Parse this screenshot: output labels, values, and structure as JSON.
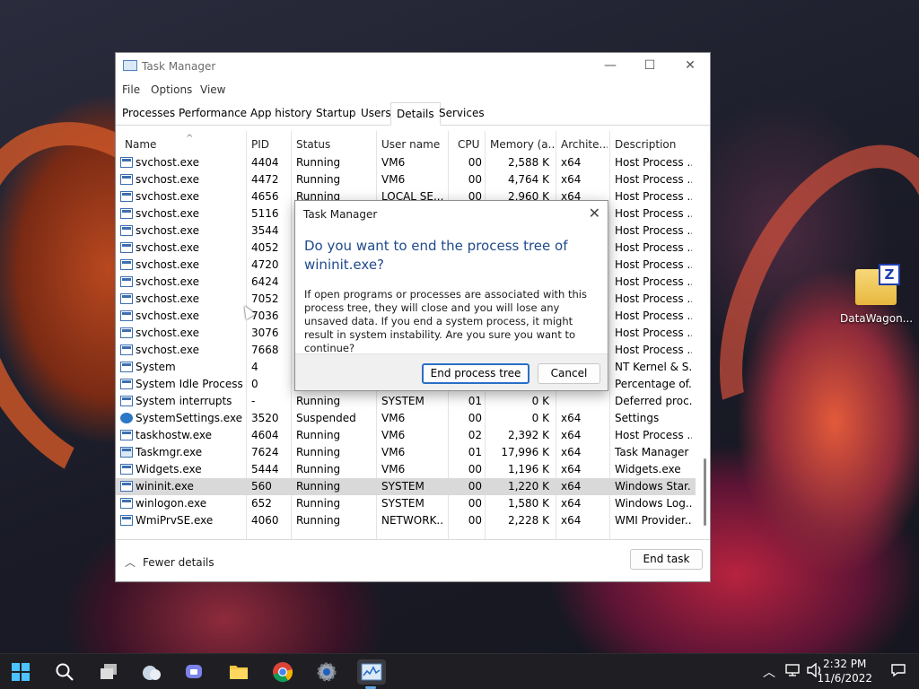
{
  "desktop": {
    "icon_label": "DataWagon...",
    "icon_badge": "Z"
  },
  "window": {
    "title": "Task Manager",
    "controls": {
      "minimize": "—",
      "maximize": "☐",
      "close": "✕"
    }
  },
  "menu": [
    "File",
    "Options",
    "View"
  ],
  "tabs": [
    {
      "label": "Processes",
      "active": false
    },
    {
      "label": "Performance",
      "active": false
    },
    {
      "label": "App history",
      "active": false
    },
    {
      "label": "Startup",
      "active": false
    },
    {
      "label": "Users",
      "active": false
    },
    {
      "label": "Details",
      "active": true
    },
    {
      "label": "Services",
      "active": false
    }
  ],
  "columns": [
    "Name",
    "PID",
    "Status",
    "User name",
    "CPU",
    "Memory (a...",
    "Archite...",
    "Description"
  ],
  "rows": [
    {
      "name": "svchost.exe",
      "pid": "4404",
      "status": "Running",
      "user": "VM6",
      "cpu": "00",
      "mem": "2,588 K",
      "arch": "x64",
      "desc": "Host Process ...",
      "icon": "process"
    },
    {
      "name": "svchost.exe",
      "pid": "4472",
      "status": "Running",
      "user": "VM6",
      "cpu": "00",
      "mem": "4,764 K",
      "arch": "x64",
      "desc": "Host Process ...",
      "icon": "process"
    },
    {
      "name": "svchost.exe",
      "pid": "4656",
      "status": "Running",
      "user": "LOCAL SE...",
      "cpu": "00",
      "mem": "2,960 K",
      "arch": "x64",
      "desc": "Host Process ...",
      "icon": "process"
    },
    {
      "name": "svchost.exe",
      "pid": "5116",
      "status": "",
      "user": "",
      "cpu": "",
      "mem": "",
      "arch": "",
      "desc": "Host Process ...",
      "icon": "process"
    },
    {
      "name": "svchost.exe",
      "pid": "3544",
      "status": "",
      "user": "",
      "cpu": "",
      "mem": "",
      "arch": "",
      "desc": "Host Process ...",
      "icon": "process"
    },
    {
      "name": "svchost.exe",
      "pid": "4052",
      "status": "",
      "user": "",
      "cpu": "",
      "mem": "",
      "arch": "",
      "desc": "Host Process ...",
      "icon": "process"
    },
    {
      "name": "svchost.exe",
      "pid": "4720",
      "status": "",
      "user": "",
      "cpu": "",
      "mem": "",
      "arch": "",
      "desc": "Host Process ...",
      "icon": "process"
    },
    {
      "name": "svchost.exe",
      "pid": "6424",
      "status": "",
      "user": "",
      "cpu": "",
      "mem": "",
      "arch": "",
      "desc": "Host Process ...",
      "icon": "process"
    },
    {
      "name": "svchost.exe",
      "pid": "7052",
      "status": "",
      "user": "",
      "cpu": "",
      "mem": "",
      "arch": "",
      "desc": "Host Process ...",
      "icon": "process"
    },
    {
      "name": "svchost.exe",
      "pid": "7036",
      "status": "",
      "user": "",
      "cpu": "",
      "mem": "",
      "arch": "",
      "desc": "Host Process ...",
      "icon": "process"
    },
    {
      "name": "svchost.exe",
      "pid": "3076",
      "status": "",
      "user": "",
      "cpu": "",
      "mem": "",
      "arch": "",
      "desc": "Host Process ...",
      "icon": "process"
    },
    {
      "name": "svchost.exe",
      "pid": "7668",
      "status": "",
      "user": "",
      "cpu": "",
      "mem": "",
      "arch": "",
      "desc": "Host Process ...",
      "icon": "process"
    },
    {
      "name": "System",
      "pid": "4",
      "status": "",
      "user": "",
      "cpu": "",
      "mem": "",
      "arch": "",
      "desc": "NT Kernel & S...",
      "icon": "process"
    },
    {
      "name": "System Idle Process",
      "pid": "0",
      "status": "",
      "user": "",
      "cpu": "",
      "mem": "",
      "arch": "",
      "desc": "Percentage of...",
      "icon": "process"
    },
    {
      "name": "System interrupts",
      "pid": "-",
      "status": "Running",
      "user": "SYSTEM",
      "cpu": "01",
      "mem": "0 K",
      "arch": "",
      "desc": "Deferred proc...",
      "icon": "process"
    },
    {
      "name": "SystemSettings.exe",
      "pid": "3520",
      "status": "Suspended",
      "user": "VM6",
      "cpu": "00",
      "mem": "0 K",
      "arch": "x64",
      "desc": "Settings",
      "icon": "gear"
    },
    {
      "name": "taskhostw.exe",
      "pid": "4604",
      "status": "Running",
      "user": "VM6",
      "cpu": "02",
      "mem": "2,392 K",
      "arch": "x64",
      "desc": "Host Process ...",
      "icon": "process"
    },
    {
      "name": "Taskmgr.exe",
      "pid": "7624",
      "status": "Running",
      "user": "VM6",
      "cpu": "01",
      "mem": "17,996 K",
      "arch": "x64",
      "desc": "Task Manager",
      "icon": "taskmgr"
    },
    {
      "name": "Widgets.exe",
      "pid": "5444",
      "status": "Running",
      "user": "VM6",
      "cpu": "00",
      "mem": "1,196 K",
      "arch": "x64",
      "desc": "Widgets.exe",
      "icon": "process"
    },
    {
      "name": "wininit.exe",
      "pid": "560",
      "status": "Running",
      "user": "SYSTEM",
      "cpu": "00",
      "mem": "1,220 K",
      "arch": "x64",
      "desc": "Windows Star...",
      "icon": "process",
      "selected": true
    },
    {
      "name": "winlogon.exe",
      "pid": "652",
      "status": "Running",
      "user": "SYSTEM",
      "cpu": "00",
      "mem": "1,580 K",
      "arch": "x64",
      "desc": "Windows Log...",
      "icon": "process"
    },
    {
      "name": "WmiPrvSE.exe",
      "pid": "4060",
      "status": "Running",
      "user": "NETWORK...",
      "cpu": "00",
      "mem": "2,228 K",
      "arch": "x64",
      "desc": "WMI Provider...",
      "icon": "process"
    }
  ],
  "footer": {
    "fewer_details": "Fewer details",
    "end_task": "End task"
  },
  "dialog": {
    "title": "Task Manager",
    "heading": "Do you want to end the process tree of wininit.exe?",
    "body": "If open programs or processes are associated with this process tree, they will close and you will lose any unsaved data. If you end a system process, it might result in system instability. Are you sure you want to continue?",
    "confirm": "End process tree",
    "cancel": "Cancel"
  },
  "taskbar": {
    "time": "2:32 PM",
    "date": "11/6/2022",
    "apps": [
      "start-icon",
      "search-icon",
      "task-view-icon",
      "widgets-icon",
      "chat-icon",
      "file-explorer-icon",
      "chrome-icon",
      "settings-icon",
      "task-manager-icon"
    ]
  }
}
